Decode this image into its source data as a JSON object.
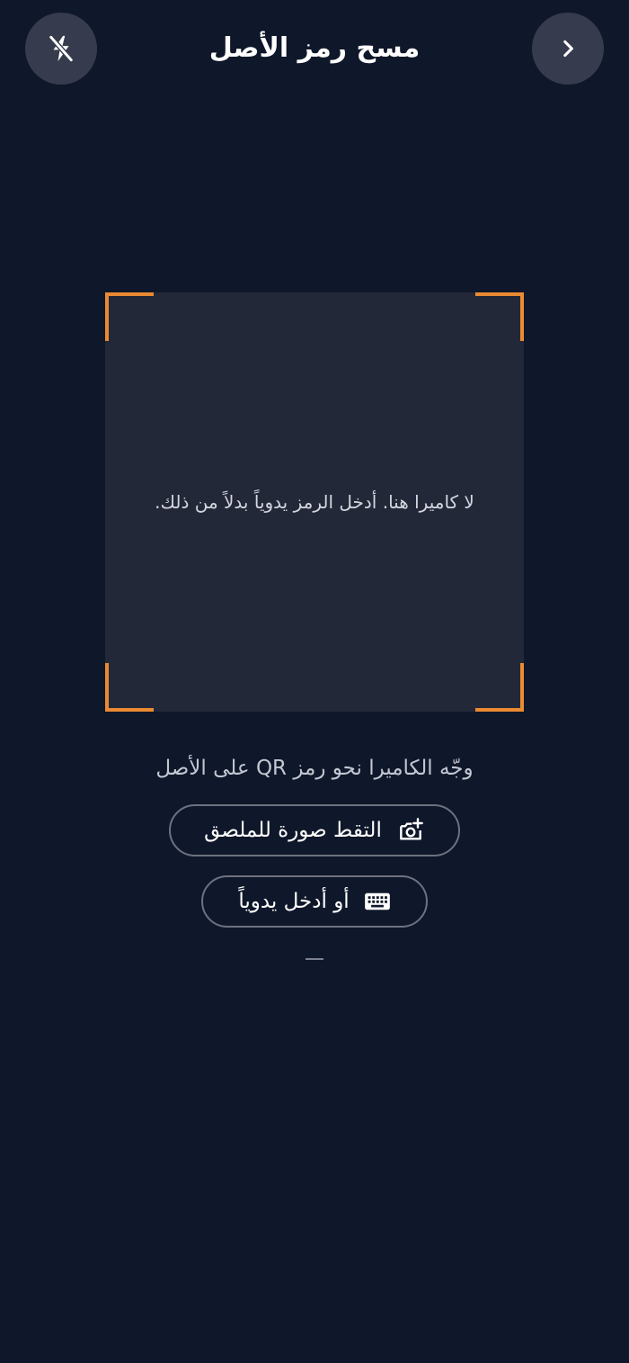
{
  "header": {
    "title": "مسح رمز الأصل",
    "back_icon": "chevron-right-icon",
    "flash_icon": "flash-off-icon"
  },
  "scanner": {
    "no_camera_message": "لا كاميرا هنا. أدخل الرمز يدوياً بدلاً من ذلك.",
    "corner_color": "#ea8a33"
  },
  "hint": "وجّه الكاميرا نحو رمز QR على الأصل",
  "actions": {
    "photo_label": "التقط صورة للملصق",
    "photo_icon": "add-camera-icon",
    "manual_label": "أو أدخل يدوياً",
    "manual_icon": "keyboard-icon"
  },
  "divider": "—",
  "colors": {
    "background": "#0f172a",
    "accent": "#ea8a33"
  }
}
